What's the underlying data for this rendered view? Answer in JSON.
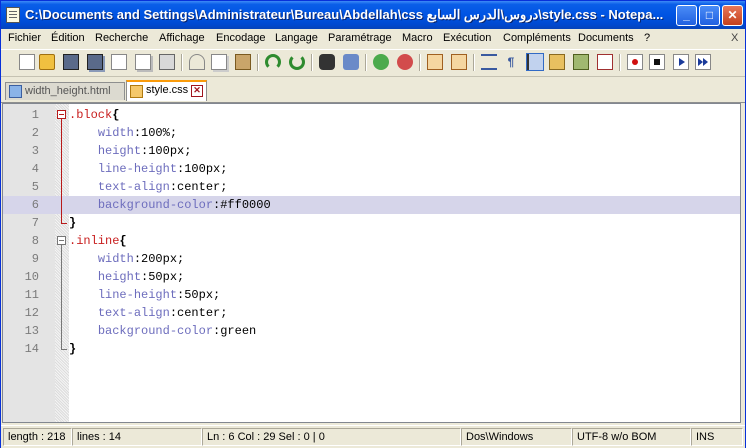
{
  "window": {
    "title": "C:\\Documents and Settings\\Administrateur\\Bureau\\Abdellah\\css دروس\\الدرس السابع\\style.css - Notepa...",
    "minimize": "_",
    "maximize": "□",
    "close": "✕"
  },
  "menu": [
    "Fichier",
    "Édition",
    "Recherche",
    "Affichage",
    "Encodage",
    "Langage",
    "Paramétrage",
    "Macro",
    "Exécution",
    "Compléments",
    "Documents",
    "?"
  ],
  "menu_close": "X",
  "toolbar_icons": [
    "new-file-icon",
    "open-folder-icon",
    "save-icon",
    "save-all-icon",
    "close-icon",
    "close-all-icon",
    "print-icon",
    "cut-icon",
    "copy-icon",
    "paste-icon",
    "undo-icon",
    "redo-icon",
    "find-icon",
    "replace-icon",
    "zoom-in-icon",
    "zoom-out-icon",
    "sync-vertical-icon",
    "sync-horizontal-icon",
    "word-wrap-icon",
    "show-all-chars-icon",
    "indent-guide-icon",
    "document-map-icon",
    "function-list-icon",
    "folder-workspace-icon",
    "record-macro-icon",
    "stop-record-icon",
    "play-macro-icon",
    "run-macro-multiple-icon"
  ],
  "tabs": [
    {
      "label": "width_height.html",
      "active": false
    },
    {
      "label": "style.css",
      "active": true
    }
  ],
  "editor": {
    "current_line": 6,
    "lines": [
      {
        "n": "1",
        "sel": ".block",
        "brace": "{"
      },
      {
        "n": "2",
        "prop": "width",
        "val": "100%;"
      },
      {
        "n": "3",
        "prop": "height",
        "val": "100px;"
      },
      {
        "n": "4",
        "prop": "line-height",
        "val": "100px;"
      },
      {
        "n": "5",
        "prop": "text-align",
        "val": "center;"
      },
      {
        "n": "6",
        "prop": "background-color",
        "val": "#ff0000"
      },
      {
        "n": "7",
        "brace": "}"
      },
      {
        "n": "8",
        "sel": ".inline",
        "brace": "{"
      },
      {
        "n": "9",
        "prop": "width",
        "val": "200px;"
      },
      {
        "n": "10",
        "prop": "height",
        "val": "50px;"
      },
      {
        "n": "11",
        "prop": "line-height",
        "val": "50px;"
      },
      {
        "n": "12",
        "prop": "text-align",
        "val": "center;"
      },
      {
        "n": "13",
        "prop": "background-color",
        "val": "green"
      },
      {
        "n": "14",
        "brace": "}"
      }
    ]
  },
  "status": {
    "length": "length : 218",
    "lines": "lines : 14",
    "position": "Ln : 6    Col : 29    Sel : 0 | 0",
    "eol": "Dos\\Windows",
    "encoding": "UTF-8 w/o BOM",
    "mode": "INS"
  }
}
